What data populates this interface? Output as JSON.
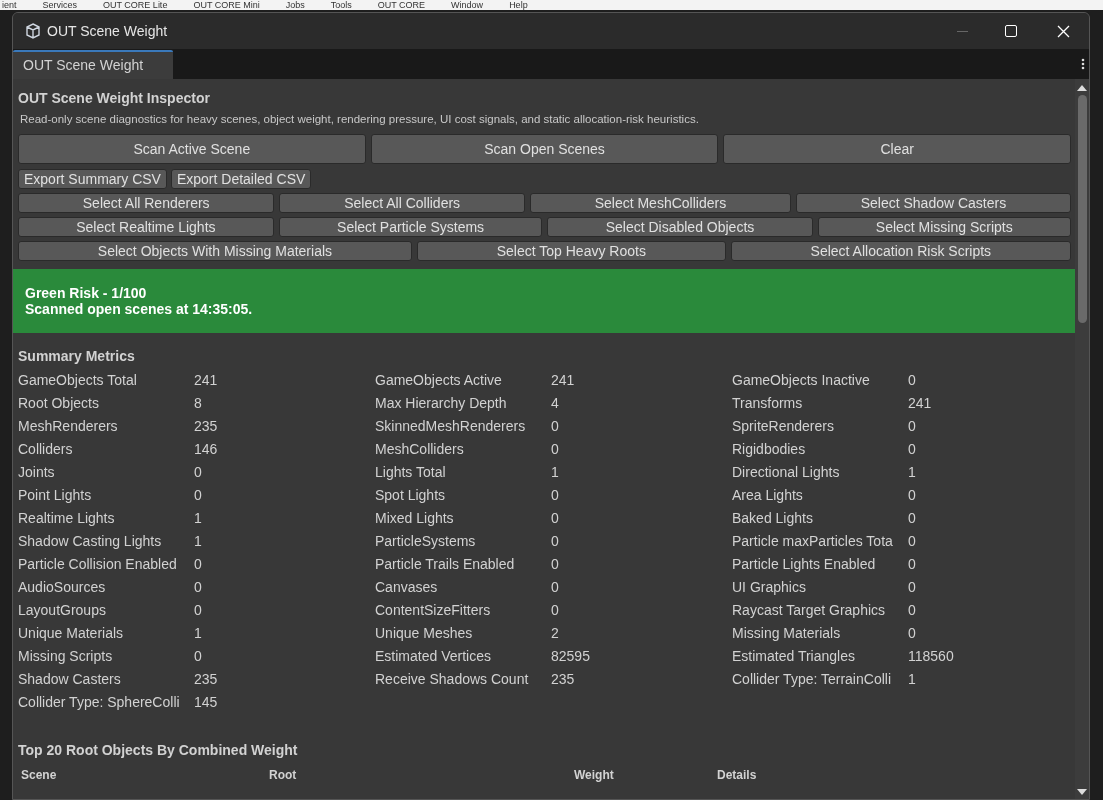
{
  "background_menu": [
    "ient",
    "Services",
    "OUT CORE Lite",
    "OUT CORE Mini",
    "Jobs",
    "Tools",
    "OUT CORE",
    "Window",
    "Help"
  ],
  "window": {
    "title": "OUT Scene Weight"
  },
  "tabs": [
    {
      "label": "OUT Scene Weight",
      "selected": true
    }
  ],
  "header": {
    "title": "OUT Scene Weight Inspector",
    "description": "Read-only scene diagnostics for heavy scenes, object weight, rendering pressure, UI cost signals, and static allocation-risk heuristics."
  },
  "button_rows": [
    [
      "Scan Active Scene",
      "Scan Open Scenes",
      "Clear"
    ],
    [
      "Export Summary CSV",
      "Export Detailed CSV"
    ],
    [
      "Select All Renderers",
      "Select All Colliders",
      "Select MeshColliders",
      "Select Shadow Casters"
    ],
    [
      "Select Realtime Lights",
      "Select Particle Systems",
      "Select Disabled Objects",
      "Select Missing Scripts"
    ],
    [
      "Select Objects With Missing Materials",
      "Select Top Heavy Roots",
      "Select Allocation Risk Scripts"
    ]
  ],
  "status": {
    "kind": "green",
    "title": "Green Risk - 1/100",
    "message": "Scanned open scenes at 14:35:05."
  },
  "summary": {
    "title": "Summary Metrics",
    "metrics": [
      {
        "label": "GameObjects Total",
        "value": "241"
      },
      {
        "label": "GameObjects Active",
        "value": "241"
      },
      {
        "label": "GameObjects Inactive",
        "value": "0"
      },
      {
        "label": "Root Objects",
        "value": "8"
      },
      {
        "label": "Max Hierarchy Depth",
        "value": "4"
      },
      {
        "label": "Transforms",
        "value": "241"
      },
      {
        "label": "MeshRenderers",
        "value": "235"
      },
      {
        "label": "SkinnedMeshRenderers",
        "value": "0"
      },
      {
        "label": "SpriteRenderers",
        "value": "0"
      },
      {
        "label": "Colliders",
        "value": "146"
      },
      {
        "label": "MeshColliders",
        "value": "0"
      },
      {
        "label": "Rigidbodies",
        "value": "0"
      },
      {
        "label": "Joints",
        "value": "0"
      },
      {
        "label": "Lights Total",
        "value": "1"
      },
      {
        "label": "Directional Lights",
        "value": "1"
      },
      {
        "label": "Point Lights",
        "value": "0"
      },
      {
        "label": "Spot Lights",
        "value": "0"
      },
      {
        "label": "Area Lights",
        "value": "0"
      },
      {
        "label": "Realtime Lights",
        "value": "1"
      },
      {
        "label": "Mixed Lights",
        "value": "0"
      },
      {
        "label": "Baked Lights",
        "value": "0"
      },
      {
        "label": "Shadow Casting Lights",
        "value": "1"
      },
      {
        "label": "ParticleSystems",
        "value": "0"
      },
      {
        "label": "Particle maxParticles Tota",
        "value": "0"
      },
      {
        "label": "Particle Collision Enabled",
        "value": "0"
      },
      {
        "label": "Particle Trails Enabled",
        "value": "0"
      },
      {
        "label": "Particle Lights Enabled",
        "value": "0"
      },
      {
        "label": "AudioSources",
        "value": "0"
      },
      {
        "label": "Canvases",
        "value": "0"
      },
      {
        "label": "UI Graphics",
        "value": "0"
      },
      {
        "label": "LayoutGroups",
        "value": "0"
      },
      {
        "label": "ContentSizeFitters",
        "value": "0"
      },
      {
        "label": "Raycast Target Graphics",
        "value": "0"
      },
      {
        "label": "Unique Materials",
        "value": "1"
      },
      {
        "label": "Unique Meshes",
        "value": "2"
      },
      {
        "label": "Missing Materials",
        "value": "0"
      },
      {
        "label": "Missing Scripts",
        "value": "0"
      },
      {
        "label": "Estimated Vertices",
        "value": "82595"
      },
      {
        "label": "Estimated Triangles",
        "value": "118560"
      },
      {
        "label": "Shadow Casters",
        "value": "235"
      },
      {
        "label": "Receive Shadows Count",
        "value": "235"
      },
      {
        "label": "Collider Type: TerrainColli",
        "value": "1"
      },
      {
        "label": "Collider Type: SphereColli",
        "value": "145"
      }
    ]
  },
  "top_roots": {
    "title": "Top 20 Root Objects By Combined Weight",
    "columns": [
      "Scene",
      "Root",
      "Weight",
      "Details"
    ]
  }
}
